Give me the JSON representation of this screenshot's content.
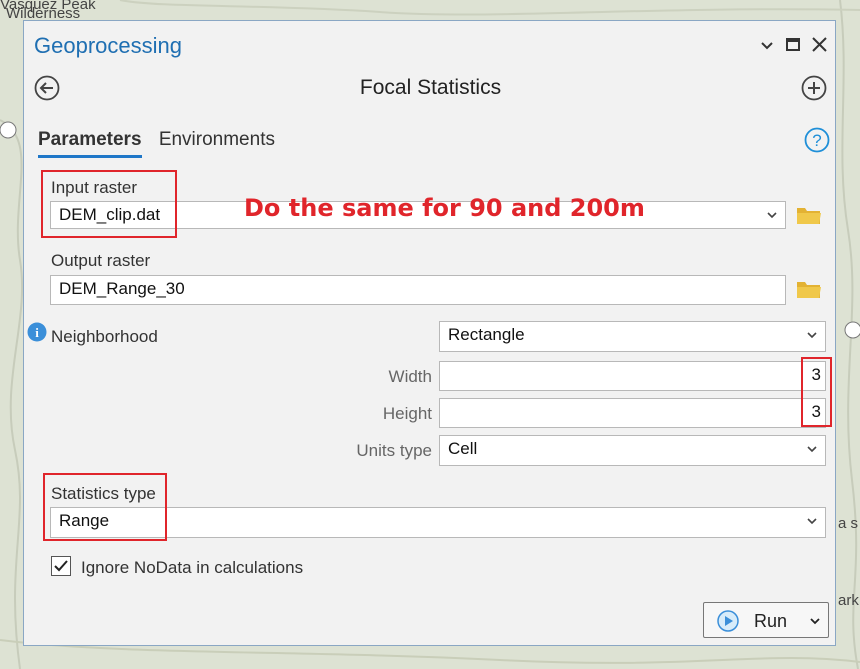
{
  "background": {
    "map_label_line1": "Vasquez Peak",
    "map_label_line2": "Wilderness",
    "edge_text_1": "a s",
    "edge_text_2": "ark"
  },
  "pane": {
    "title": "Geoprocessing",
    "tool_title": "Focal Statistics",
    "tabs": [
      "Parameters",
      "Environments"
    ],
    "active_tab": "Parameters"
  },
  "params": {
    "input_raster": {
      "label": "Input raster",
      "value": "DEM_clip.dat"
    },
    "output_raster": {
      "label": "Output raster",
      "value": "DEM_Range_30"
    },
    "neighborhood": {
      "label": "Neighborhood",
      "value": "Rectangle"
    },
    "width": {
      "label": "Width",
      "value": "3"
    },
    "height": {
      "label": "Height",
      "value": "3"
    },
    "units_type": {
      "label": "Units type",
      "value": "Cell"
    },
    "statistics_type": {
      "label": "Statistics type",
      "value": "Range"
    },
    "ignore_nodata": {
      "label": "Ignore NoData in calculations",
      "checked": true
    }
  },
  "annotation": {
    "text": "Do the same for 90 and 200m",
    "color": "#e0252b"
  },
  "run_button": {
    "label": "Run"
  },
  "colors": {
    "accent": "#1f77c8",
    "title": "#1f6fb2",
    "annotation": "#e0252b"
  }
}
